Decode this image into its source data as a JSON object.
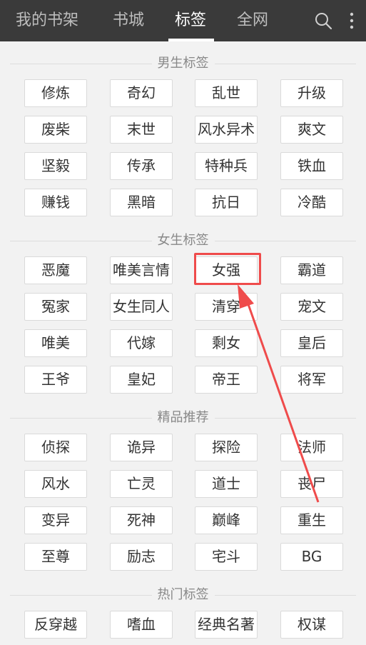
{
  "header": {
    "tabs": [
      {
        "label": "我的书架",
        "active": false
      },
      {
        "label": "书城",
        "active": false
      },
      {
        "label": "标签",
        "active": true
      },
      {
        "label": "全网",
        "active": false
      }
    ],
    "search_icon": "search-icon",
    "menu_icon": "more-vertical-icon"
  },
  "sections": [
    {
      "title": "男生标签",
      "tags": [
        "修炼",
        "奇幻",
        "乱世",
        "升级",
        "废柴",
        "末世",
        "风水异术",
        "爽文",
        "坚毅",
        "传承",
        "特种兵",
        "铁血",
        "赚钱",
        "黑暗",
        "抗日",
        "冷酷"
      ]
    },
    {
      "title": "女生标签",
      "tags": [
        "恶魔",
        "唯美言情",
        "女强",
        "霸道",
        "冤家",
        "女生同人",
        "清穿",
        "宠文",
        "唯美",
        "代嫁",
        "剩女",
        "皇后",
        "王爷",
        "皇妃",
        "帝王",
        "将军"
      ]
    },
    {
      "title": "精品推荐",
      "tags": [
        "侦探",
        "诡异",
        "探险",
        "法师",
        "风水",
        "亡灵",
        "道士",
        "丧尸",
        "变异",
        "死神",
        "巅峰",
        "重生",
        "至尊",
        "励志",
        "宅斗",
        "BG"
      ]
    },
    {
      "title": "热门标签",
      "tags": [
        "反穿越",
        "嗜血",
        "经典名著",
        "权谋"
      ]
    }
  ],
  "annotation": {
    "highlighted_tag": "女强",
    "color": "#ef4b4b"
  },
  "colors": {
    "topbar": "#3a3a3a",
    "background": "#f2f2f2",
    "tag_border": "#dadada"
  }
}
